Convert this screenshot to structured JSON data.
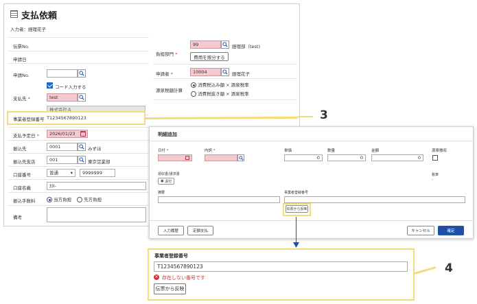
{
  "main": {
    "title": "支払依頼",
    "inputter": "入力者：経理花子",
    "fields": {
      "slip_no": "伝票No.",
      "request_date": "申請日",
      "request_no": "申請No.",
      "code_input": "コード入力する",
      "payee": "支払先",
      "payee_value": "test",
      "company": "株式会社Ａ",
      "reg_no_label": "事業者登録番号",
      "reg_no_value": "T1234567890123",
      "pay_date_label": "支払予定日",
      "pay_date_value": "2026/01/23",
      "bank_label": "振込先",
      "bank_code": "0001",
      "bank_name": "みずほ",
      "branch_label": "振込先支店",
      "branch_code": "001",
      "branch_name": "東京営業部",
      "account_no_label": "口座番号",
      "account_type": "普通",
      "account_no": "9999999",
      "account_name_label": "口座名義",
      "account_name": "ｶ)I-",
      "fee_label": "振込手数料",
      "fee_option1": "当方負担",
      "fee_option2": "先方負担",
      "remarks_label": "備考",
      "dept_label": "負担部門",
      "dept_code": "99",
      "dept_name": "経理部（test)",
      "allocate_button": "費用を按分する",
      "applicant_label": "申請者",
      "applicant_code": "10004",
      "applicant_name": "経理花子",
      "tax_label": "源泉税額計算",
      "tax_option1": "消費税込み額 × 源泉税率",
      "tax_option2": "消費税抜き額 × 源泉税率"
    }
  },
  "modal": {
    "title": "明細追加",
    "date_label": "日付",
    "item_label": "内訳",
    "unit_price_label": "単価",
    "quantity_label": "数量",
    "amount_label": "金額",
    "withholding_label": "源泉徴収",
    "unit_price_value": "0",
    "quantity_value": "0",
    "amount_value": "0",
    "receipt_label": "領収書/請求書",
    "attach_button": "添付",
    "tax_rate_label": "税率",
    "tax_rate_value": "-",
    "summary_label": "摘要",
    "reg_no_label": "事業者登録番号",
    "reflect_button": "伝票から反映",
    "history_button": "入力履歴",
    "fixed_button": "定額支払",
    "cancel_button": "キャンセル",
    "confirm_button": "確定"
  },
  "zoom": {
    "label": "事業者登録番号",
    "value": "T1234567890123",
    "error": "存在しない番号です",
    "reflect_button": "伝票から反映"
  },
  "callouts": {
    "n3": "3",
    "n4": "4"
  },
  "colors": {
    "required_pink": "#f6c8cf",
    "highlight_yellow": "#f5dc7a",
    "primary_blue": "#1f4fa8",
    "error_red": "#d33333"
  }
}
